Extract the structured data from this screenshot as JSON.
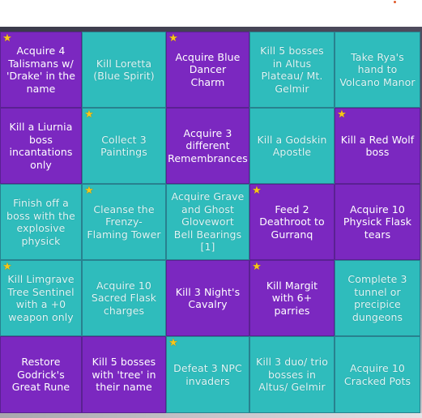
{
  "colors": {
    "purple": "#7b28c0",
    "teal": "#2fbcbc",
    "star": "#f7c619"
  },
  "board": {
    "cells": [
      {
        "label": "Acquire 4 Talismans w/ 'Drake' in the name",
        "color": "purple",
        "star": true
      },
      {
        "label": "Kill Loretta (Blue Spirit)",
        "color": "teal",
        "star": false
      },
      {
        "label": "Acquire Blue Dancer Charm",
        "color": "purple",
        "star": true
      },
      {
        "label": "Kill 5 bosses in Altus Plateau/ Mt. Gelmir",
        "color": "teal",
        "star": false
      },
      {
        "label": "Take Rya's hand to Volcano Manor",
        "color": "teal",
        "star": false
      },
      {
        "label": "Kill a Liurnia boss incantations only",
        "color": "purple",
        "star": false
      },
      {
        "label": "Collect 3 Paintings",
        "color": "teal",
        "star": true
      },
      {
        "label": "Acquire 3 different Remembrances",
        "color": "purple",
        "star": false
      },
      {
        "label": "Kill a Godskin Apostle",
        "color": "teal",
        "star": false
      },
      {
        "label": "Kill a Red Wolf boss",
        "color": "purple",
        "star": true
      },
      {
        "label": "Finish off a boss with the explosive physick",
        "color": "teal",
        "star": false
      },
      {
        "label": "Cleanse the Frenzy-Flaming Tower",
        "color": "teal",
        "star": true
      },
      {
        "label": "Acquire Grave and Ghost Glovewort Bell Bearings [1]",
        "color": "teal",
        "star": false
      },
      {
        "label": "Feed 2 Deathroot to Gurranq",
        "color": "purple",
        "star": true
      },
      {
        "label": "Acquire 10 Physick Flask tears",
        "color": "purple",
        "star": false
      },
      {
        "label": "Kill Limgrave Tree Sentinel with a +0 weapon only",
        "color": "teal",
        "star": true
      },
      {
        "label": "Acquire 10 Sacred Flask charges",
        "color": "teal",
        "star": false
      },
      {
        "label": "Kill 3 Night's Cavalry",
        "color": "purple",
        "star": false
      },
      {
        "label": "Kill Margit with 6+ parries",
        "color": "purple",
        "star": true
      },
      {
        "label": "Complete 3 tunnel or precipice dungeons",
        "color": "teal",
        "star": false
      },
      {
        "label": "Restore Godrick's Great Rune",
        "color": "purple",
        "star": false
      },
      {
        "label": "Kill 5 bosses with 'tree' in their name",
        "color": "purple",
        "star": false
      },
      {
        "label": "Defeat 3 NPC invaders",
        "color": "teal",
        "star": true
      },
      {
        "label": "Kill 3 duo/ trio bosses in Altus/ Gelmir",
        "color": "teal",
        "star": false
      },
      {
        "label": "Acquire 10 Cracked Pots",
        "color": "teal",
        "star": false
      }
    ]
  }
}
